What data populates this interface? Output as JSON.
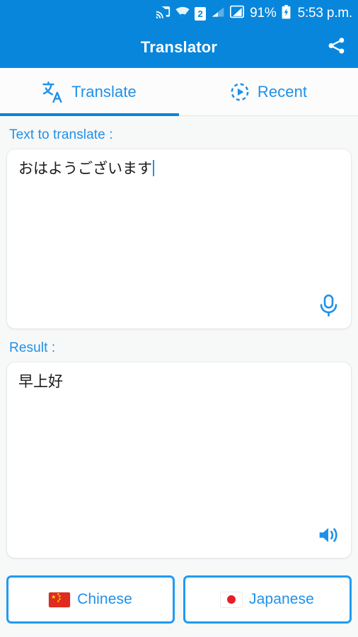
{
  "theme": {
    "primary": "#0886dc",
    "accent": "#1f90e8",
    "button_border": "#1f9bf3",
    "page_background": "#f7f8f8",
    "card_background": "#ffffff",
    "text_color": "#1b1b1b"
  },
  "status_bar": {
    "icons": [
      {
        "name": "cast-icon",
        "label": "cast"
      },
      {
        "name": "wifi-icon",
        "label": "wifi"
      },
      {
        "name": "sim-2-icon",
        "label": "2"
      },
      {
        "name": "signal-1-icon",
        "label": "signal 1"
      },
      {
        "name": "signal-2-icon",
        "label": "signal 2"
      }
    ],
    "battery_percent": "91%",
    "battery_state": "charging",
    "time": "5:53 p.m."
  },
  "app_bar": {
    "title": "Translator",
    "share_icon": "share-icon"
  },
  "tabs": [
    {
      "label": "Translate",
      "icon": "translate-icon",
      "active": true
    },
    {
      "label": "Recent",
      "icon": "history-icon",
      "active": false
    }
  ],
  "input_section": {
    "label": "Text to translate :",
    "value": "おはようございます",
    "placeholder": "",
    "action_icon": "microphone-icon"
  },
  "result_section": {
    "label": "Result :",
    "value": "早上好",
    "placeholder": "",
    "action_icon": "speaker-icon"
  },
  "language_buttons": [
    {
      "label": "Chinese",
      "flag": "flag-china",
      "role": "target-language"
    },
    {
      "label": "Japanese",
      "flag": "flag-japan",
      "role": "source-language"
    }
  ]
}
